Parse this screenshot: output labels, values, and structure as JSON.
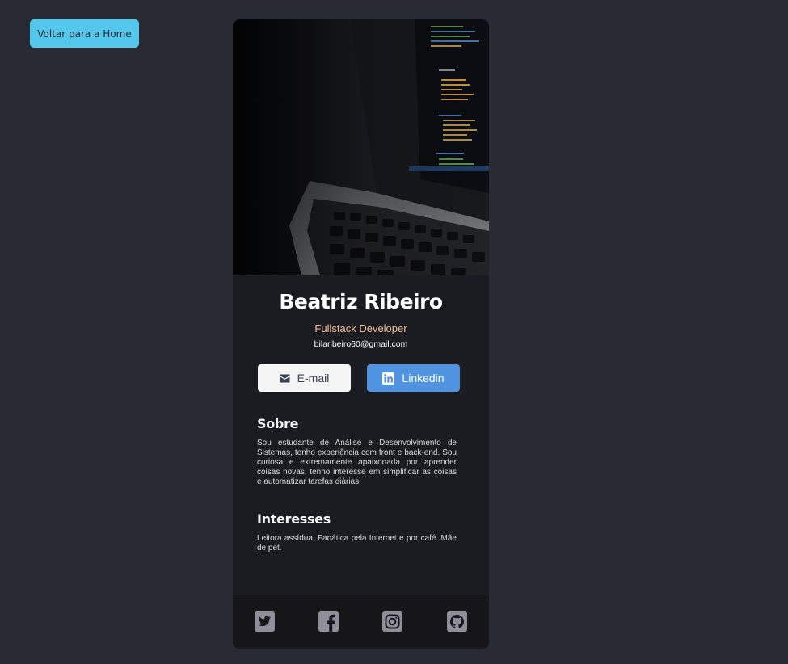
{
  "back_button": {
    "label": "Voltar para a Home"
  },
  "profile": {
    "name": "Beatriz Ribeiro",
    "role": "Fullstack Developer",
    "email": "bilaribeiro60@gmail.com"
  },
  "actions": {
    "email_label": "E-mail",
    "linkedin_label": "Linkedin"
  },
  "about": {
    "title": "Sobre",
    "text": "Sou estudante de Análise e Desenvolvimento de Sistemas, tenho experiência com front e back-end. Sou curiosa e extremamente apaixonada por aprender coisas novas, tenho interesse em simplificar as coisas e automatizar tarefas diárias."
  },
  "interests": {
    "title": "Interesses",
    "text": "Leitora assídua. Fanática pela Internet e por café. Mãe de pet."
  },
  "social_icons": [
    "twitter-icon",
    "facebook-icon",
    "instagram-icon",
    "github-icon"
  ],
  "colors": {
    "page_bg": "#282b33",
    "card_bg": "#1b1c21",
    "footer_bg": "#161619",
    "accent_home": "#53c8ec",
    "role_color": "#f3bf99",
    "linkedin_blue": "#5093e1",
    "social_icon": "#918e9b"
  }
}
